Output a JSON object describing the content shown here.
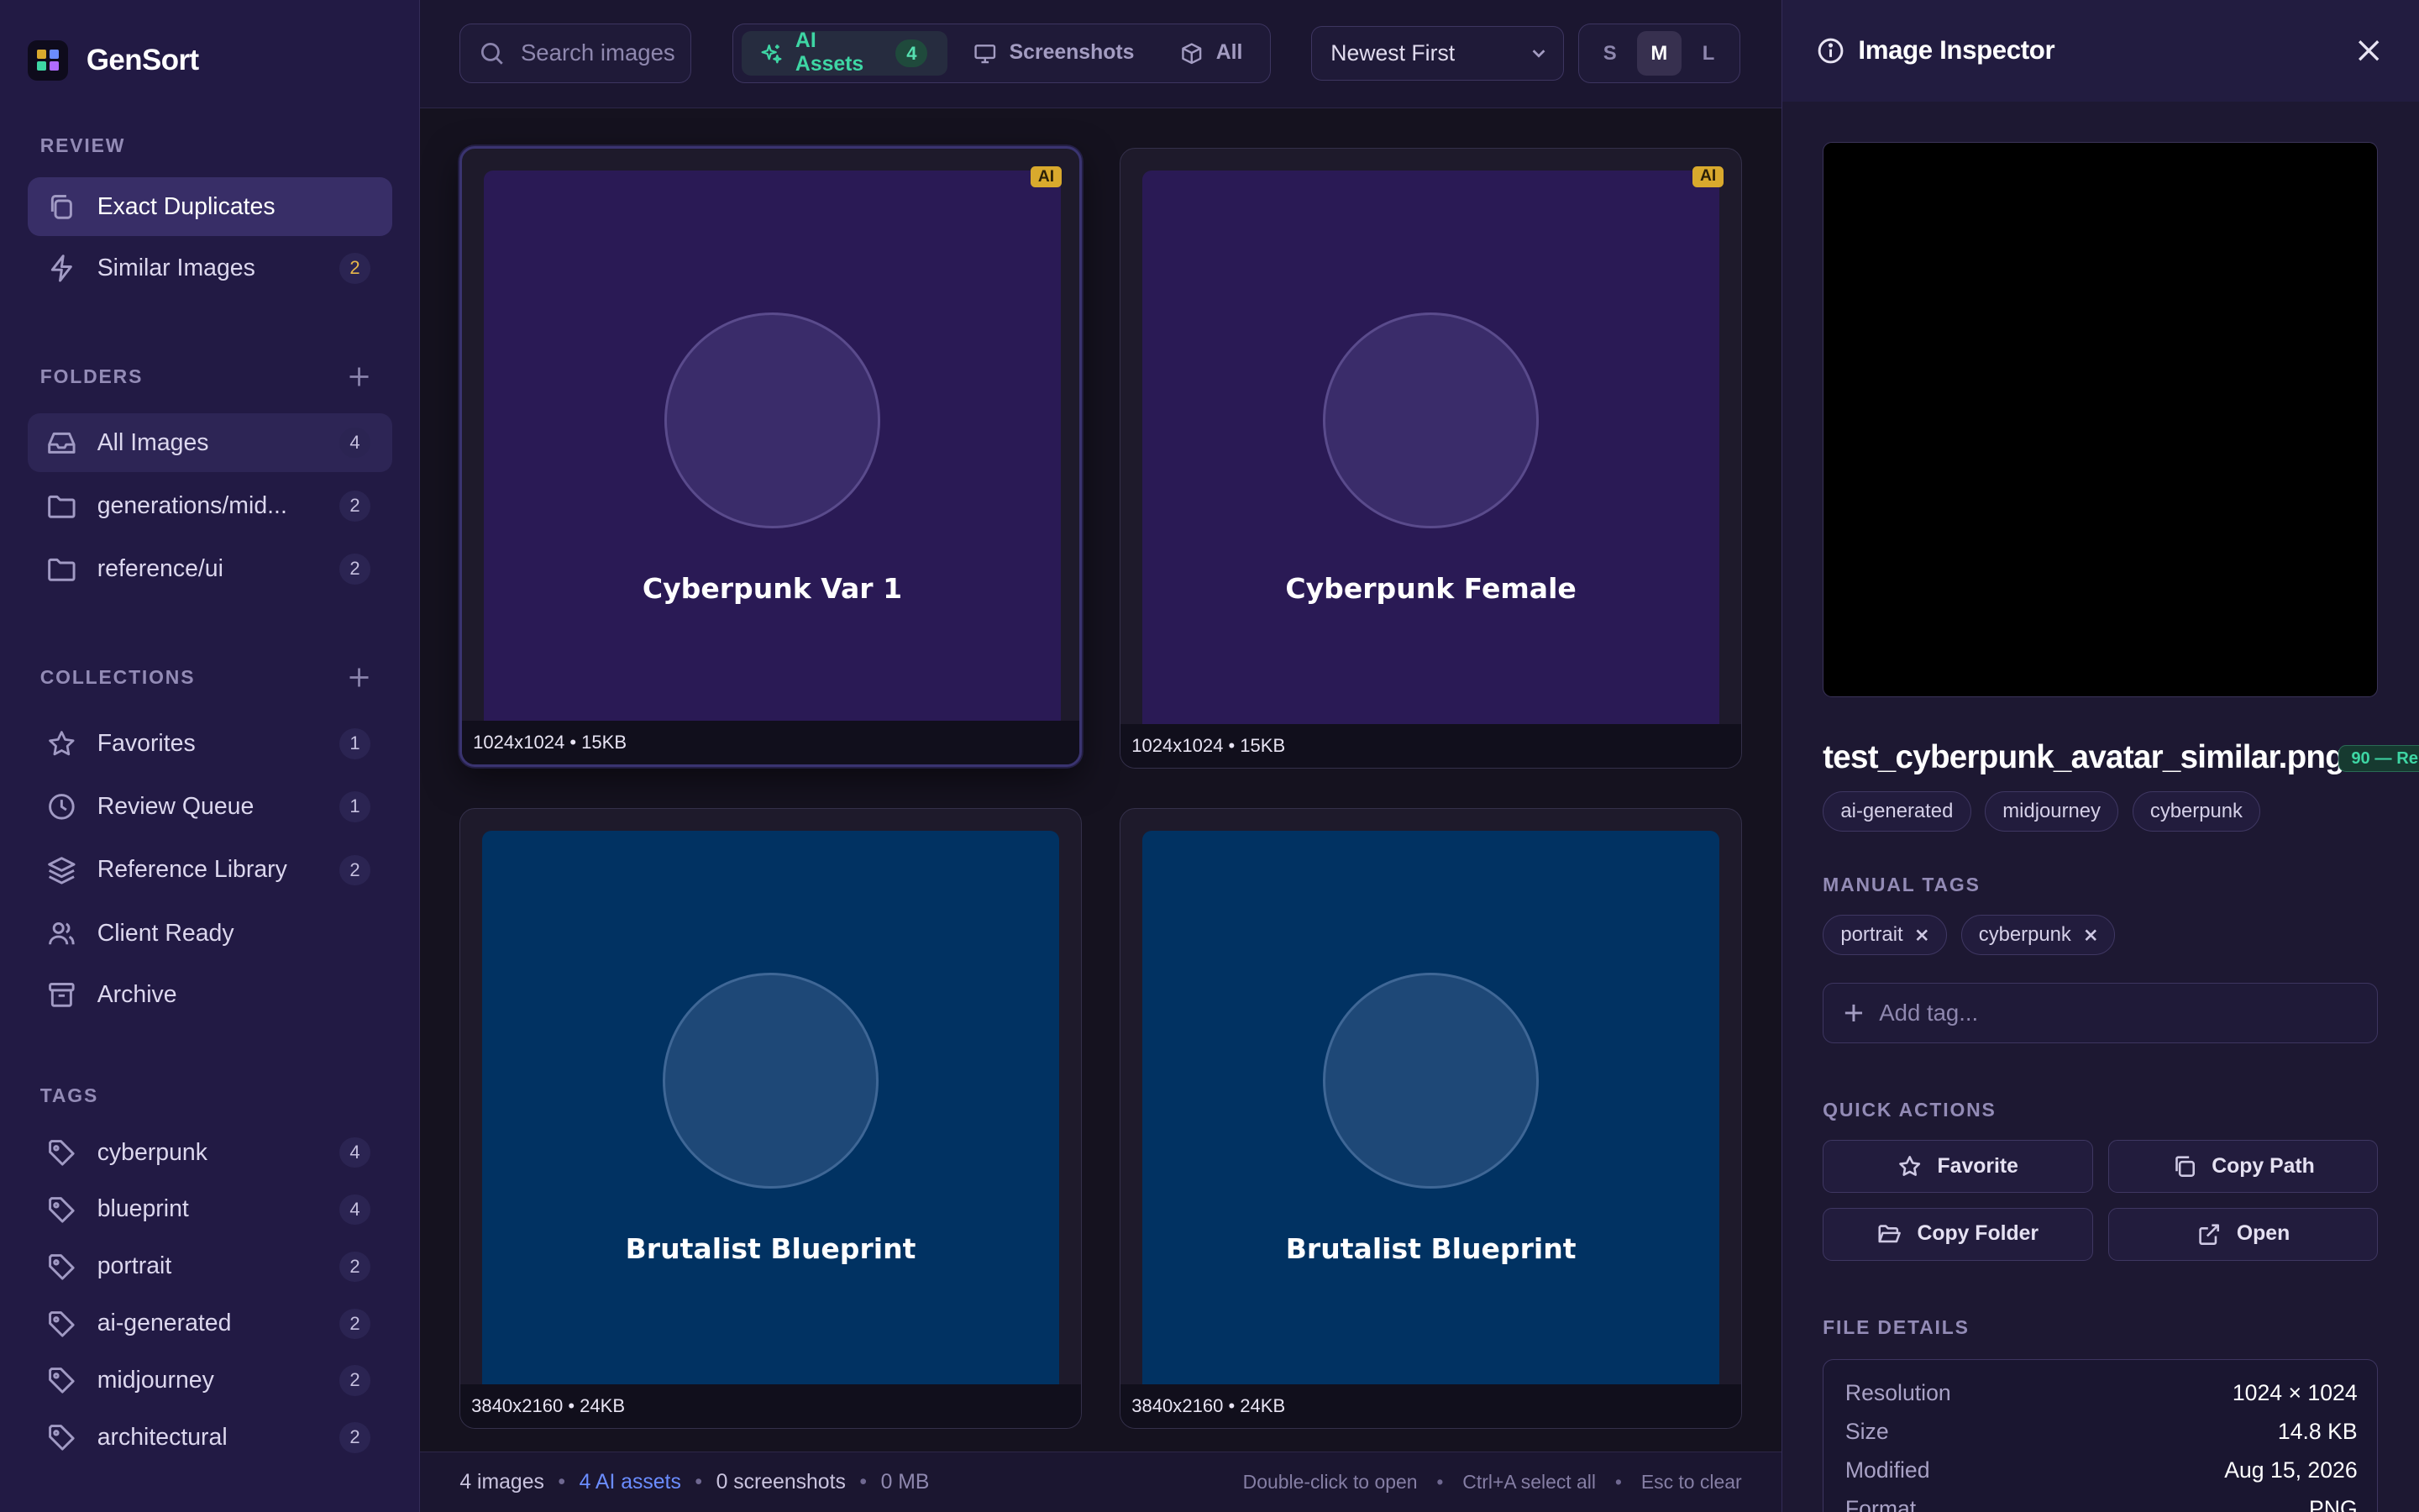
{
  "app": {
    "name": "GenSort"
  },
  "sidebar": {
    "review": {
      "heading": "REVIEW",
      "items": [
        {
          "label": "Exact Duplicates",
          "count": ""
        },
        {
          "label": "Similar Images",
          "count": "2"
        }
      ]
    },
    "folders": {
      "heading": "FOLDERS",
      "items": [
        {
          "label": "All Images",
          "count": "4"
        },
        {
          "label": "generations/mid...",
          "count": "2"
        },
        {
          "label": "reference/ui",
          "count": "2"
        }
      ]
    },
    "collections": {
      "heading": "COLLECTIONS",
      "items": [
        {
          "label": "Favorites",
          "count": "1"
        },
        {
          "label": "Review Queue",
          "count": "1"
        },
        {
          "label": "Reference Library",
          "count": "2"
        },
        {
          "label": "Client Ready",
          "count": ""
        },
        {
          "label": "Archive",
          "count": ""
        }
      ]
    },
    "tags": {
      "heading": "TAGS",
      "items": [
        {
          "label": "cyberpunk",
          "count": "4"
        },
        {
          "label": "blueprint",
          "count": "4"
        },
        {
          "label": "portrait",
          "count": "2"
        },
        {
          "label": "ai-generated",
          "count": "2"
        },
        {
          "label": "midjourney",
          "count": "2"
        },
        {
          "label": "architectural",
          "count": "2"
        }
      ]
    }
  },
  "toolbar": {
    "search_placeholder": "Search images...",
    "filters": [
      {
        "label": "AI Assets",
        "count": "4"
      },
      {
        "label": "Screenshots"
      },
      {
        "label": "All"
      }
    ],
    "sort_value": "Newest First",
    "sizes": [
      "S",
      "M",
      "L"
    ],
    "active_size": "M"
  },
  "grid": {
    "cards": [
      {
        "title": "Cyberpunk Var 1",
        "meta": "1024x1024 • 15KB",
        "badge": "AI"
      },
      {
        "title": "Cyberpunk Female",
        "meta": "1024x1024 • 15KB",
        "badge": "AI"
      },
      {
        "title": "Brutalist Blueprint",
        "meta": "3840x2160 • 24KB",
        "badge": ""
      },
      {
        "title": "Brutalist Blueprint",
        "meta": "3840x2160 • 24KB",
        "badge": ""
      }
    ]
  },
  "status": {
    "images": "4 images",
    "ai_assets": "4 AI assets",
    "screenshots": "0 screenshots",
    "size": "0 MB",
    "hint_open": "Double-click to open",
    "hint_select": "Ctrl+A select all",
    "hint_clear": "Esc to clear",
    "separator": "•"
  },
  "inspector": {
    "title": "Image Inspector",
    "filename": "test_cyberpunk_avatar_similar.png",
    "score": "90 — Re",
    "auto_tags": [
      "ai-generated",
      "midjourney",
      "cyberpunk"
    ],
    "manual_tags_heading": "MANUAL TAGS",
    "manual_tags": [
      "portrait",
      "cyberpunk"
    ],
    "add_tag_placeholder": "Add tag...",
    "quick_actions_heading": "QUICK ACTIONS",
    "actions": {
      "favorite": "Favorite",
      "copy_path": "Copy Path",
      "copy_folder": "Copy Folder",
      "open": "Open"
    },
    "file_details_heading": "FILE DETAILS",
    "details": [
      {
        "key": "Resolution",
        "value": "1024 × 1024"
      },
      {
        "key": "Size",
        "value": "14.8 KB"
      },
      {
        "key": "Modified",
        "value": "Aug 15, 2026"
      },
      {
        "key": "Format",
        "value": "PNG"
      }
    ]
  },
  "colors": {
    "sidebar_bg": "#221a44",
    "accent_green": "#3ed6a4",
    "ai_badge": "#d9a92d",
    "link_blue": "#6b8dff"
  }
}
